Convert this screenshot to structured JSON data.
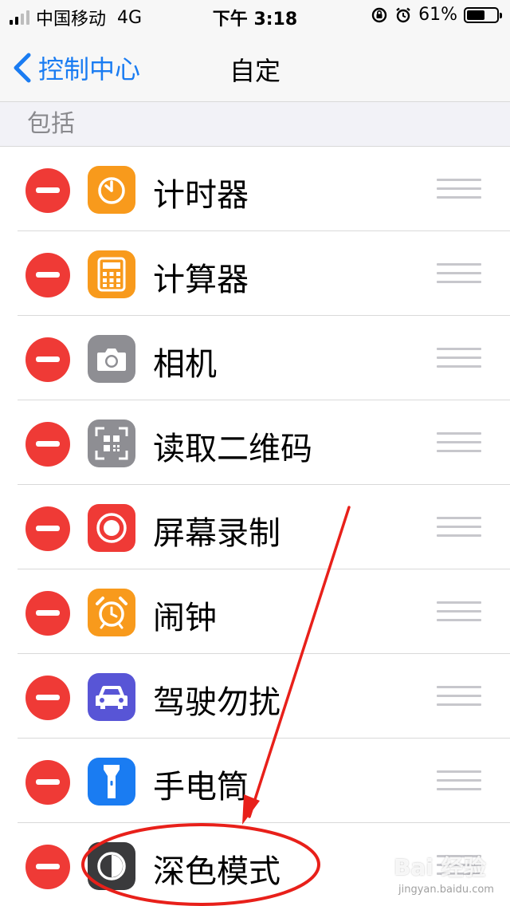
{
  "status_bar": {
    "carrier": "中国移动",
    "network": "4G",
    "time": "下午 3:18",
    "battery": "61%",
    "battery_level": 0.61
  },
  "nav": {
    "back_label": "控制中心",
    "title": "自定"
  },
  "section": {
    "label": "包括"
  },
  "items": [
    {
      "label": "计时器",
      "icon": "timer-icon",
      "color": "#f89a1c"
    },
    {
      "label": "计算器",
      "icon": "calculator-icon",
      "color": "#f89a1c"
    },
    {
      "label": "相机",
      "icon": "camera-icon",
      "color": "#8e8e93"
    },
    {
      "label": "读取二维码",
      "icon": "qr-code-icon",
      "color": "#8e8e93"
    },
    {
      "label": "屏幕录制",
      "icon": "screen-record-icon",
      "color": "#ef3a36"
    },
    {
      "label": "闹钟",
      "icon": "alarm-icon",
      "color": "#f89a1c"
    },
    {
      "label": "驾驶勿扰",
      "icon": "car-icon",
      "color": "#5855d6"
    },
    {
      "label": "手电筒",
      "icon": "flashlight-icon",
      "color": "#1a7cf2"
    },
    {
      "label": "深色模式",
      "icon": "dark-mode-icon",
      "color": "#3a3a3c"
    }
  ],
  "watermark": {
    "text": "Bai 经验",
    "sub": "jingyan.baidu.com"
  },
  "colors": {
    "accent": "#1a7cf2",
    "delete": "#ef3a36",
    "annotation": "#e8201a"
  }
}
